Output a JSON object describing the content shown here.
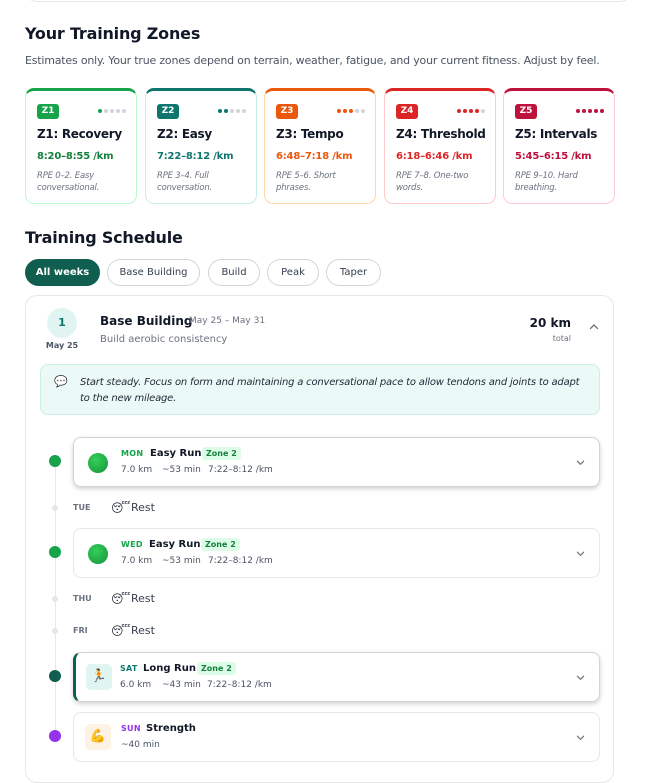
{
  "zones_section": {
    "title": "Your Training Zones",
    "subtitle": "Estimates only. Your true zones depend on terrain, weather, fatigue, and your current fitness. Adjust by feel.",
    "zones": [
      {
        "badge": "Z1",
        "name": "Z1: Recovery",
        "pace": "8:20–8:55 /km",
        "desc": "RPE 0–2. Easy conversational.",
        "level": 1,
        "color": "#16a34a"
      },
      {
        "badge": "Z2",
        "name": "Z2: Easy",
        "pace": "7:22–8:12 /km",
        "desc": "RPE 3–4. Full conversation.",
        "level": 2,
        "color": "#0f766e"
      },
      {
        "badge": "Z3",
        "name": "Z3: Tempo",
        "pace": "6:48–7:18 /km",
        "desc": "RPE 5–6. Short phrases.",
        "level": 3,
        "color": "#ea580c"
      },
      {
        "badge": "Z4",
        "name": "Z4: Threshold",
        "pace": "6:18–6:46 /km",
        "desc": "RPE 7–8. One-two words.",
        "level": 4,
        "color": "#dc2626"
      },
      {
        "badge": "Z5",
        "name": "Z5: Intervals",
        "pace": "5:45–6:15 /km",
        "desc": "RPE 9–10. Hard breathing.",
        "level": 5,
        "color": "#be123c"
      }
    ]
  },
  "schedule": {
    "title": "Training Schedule",
    "filters": [
      {
        "label": "All weeks",
        "active": true
      },
      {
        "label": "Base Building",
        "active": false
      },
      {
        "label": "Build",
        "active": false
      },
      {
        "label": "Peak",
        "active": false
      },
      {
        "label": "Taper",
        "active": false
      }
    ],
    "week": {
      "number": "1",
      "date": "May 25",
      "phase": "Base Building",
      "range": "May 25 – May 31",
      "goal": "Build aerobic consistency",
      "distance": "20 km",
      "distance_label": "total",
      "note": "Start steady. Focus on form and maintaining a conversational pace to allow tendons and joints to adapt to the new mileage.",
      "days": [
        {
          "day": "MON",
          "type": "Easy Run",
          "zone": "Zone 2",
          "dist": "7.0 km",
          "time": "~53 min",
          "pace": "7:22–8:12 /km",
          "kind": "run"
        },
        {
          "day": "TUE",
          "type": "Rest",
          "kind": "rest"
        },
        {
          "day": "WED",
          "type": "Easy Run",
          "zone": "Zone 2",
          "dist": "7.0 km",
          "time": "~53 min",
          "pace": "7:22–8:12 /km",
          "kind": "run"
        },
        {
          "day": "THU",
          "type": "Rest",
          "kind": "rest"
        },
        {
          "day": "FRI",
          "type": "Rest",
          "kind": "rest"
        },
        {
          "day": "SAT",
          "type": "Long Run",
          "zone": "Zone 2",
          "dist": "6.0 km",
          "time": "~43 min",
          "pace": "7:22–8:12 /km",
          "kind": "long"
        },
        {
          "day": "SUN",
          "type": "Strength",
          "time": "~40 min",
          "kind": "strength"
        }
      ]
    }
  },
  "colors": {
    "brand": "#0f5e4f",
    "run_green": "#16a34a",
    "strength_purple": "#9333ea"
  },
  "icons": {
    "note": "speech-bubble-icon",
    "rest": "sleeping-face-icon",
    "long_run": "runner-icon",
    "strength": "flexed-biceps-icon",
    "expand": "chevron-down-icon",
    "collapse": "chevron-up-icon"
  }
}
